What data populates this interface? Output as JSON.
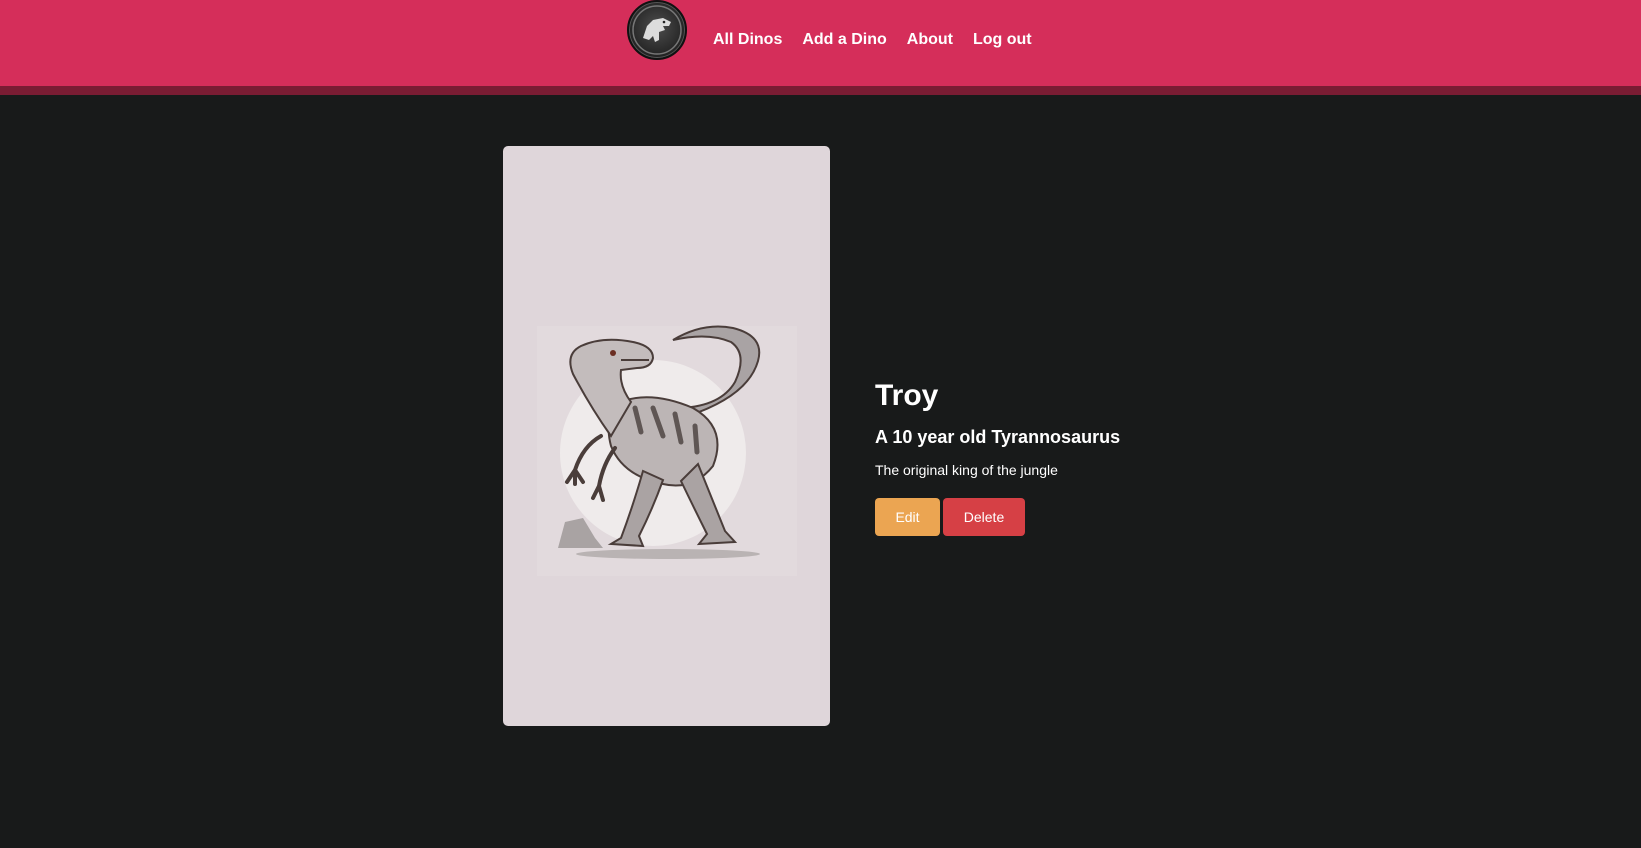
{
  "nav": {
    "logo_icon": "jurassic-trex-logo-icon",
    "links": [
      "All Dinos",
      "Add a Dino",
      "About",
      "Log out"
    ]
  },
  "dino": {
    "image_icon": "raptor-illustration",
    "name": "Troy",
    "subtitle": "A 10 year old Tyrannosaurus",
    "description": "The original king of the jungle"
  },
  "actions": {
    "edit_label": "Edit",
    "delete_label": "Delete"
  },
  "colors": {
    "header": "#d52e5a",
    "header_border": "#7a1c33",
    "background": "#181a1a",
    "image_bg": "#dfd6da",
    "edit": "#eba552",
    "delete": "#d64045"
  }
}
